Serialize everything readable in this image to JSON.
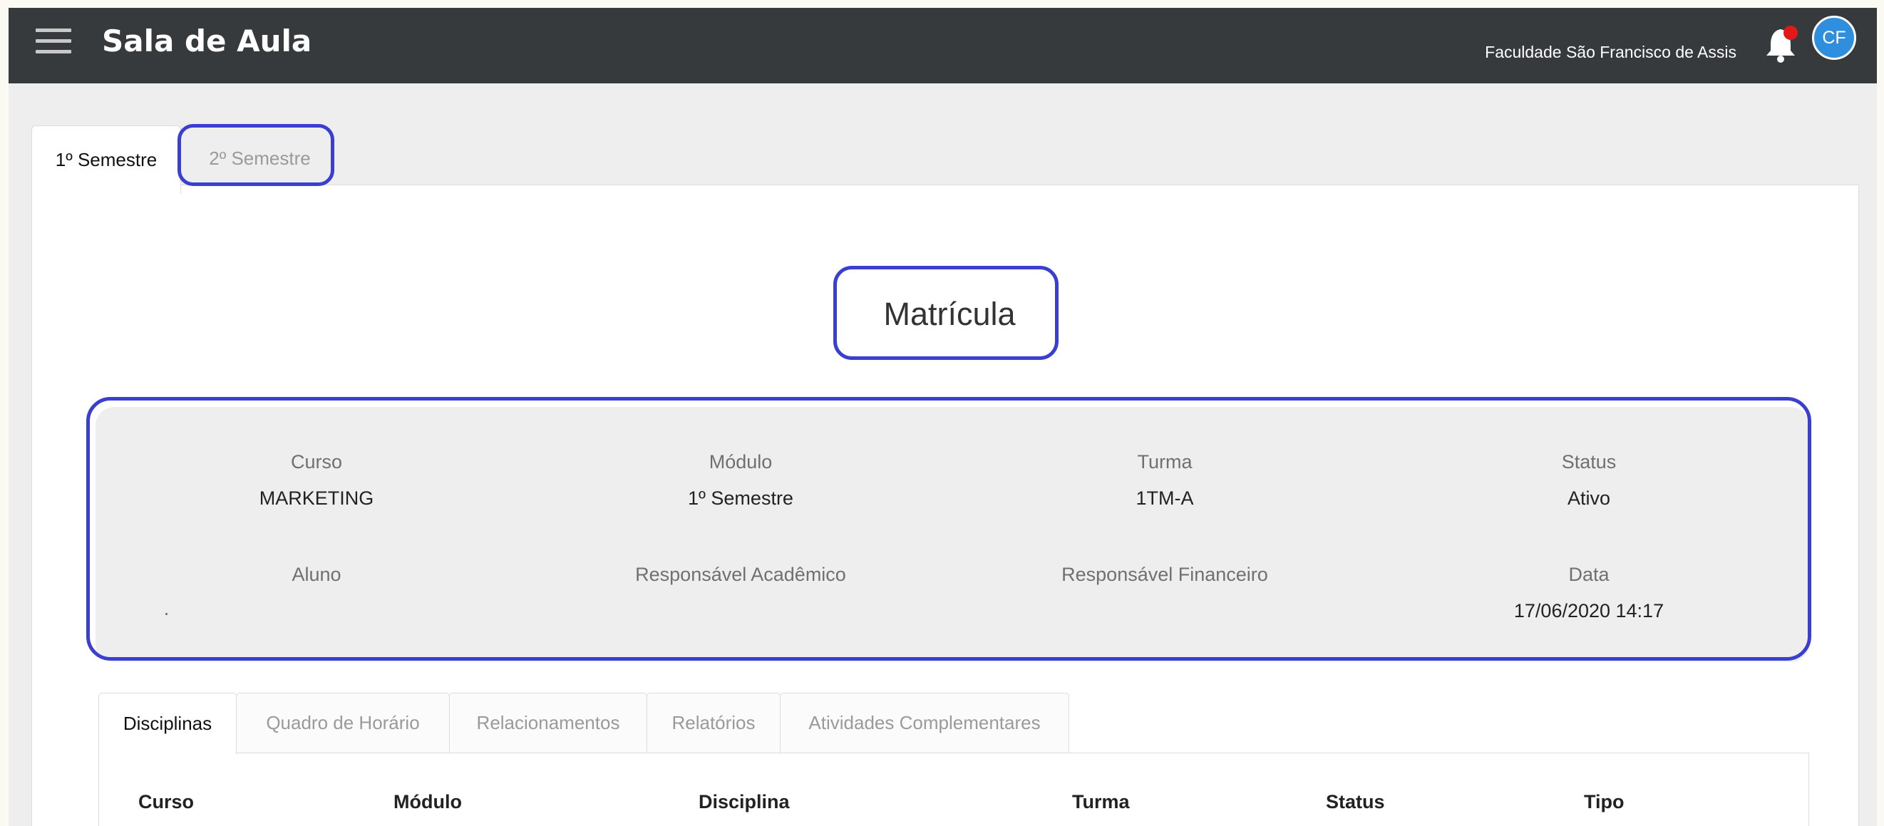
{
  "header": {
    "title": "Sala de Aula",
    "institution": "Faculdade São Francisco de Assis",
    "avatar_initials": "CF",
    "notification": true,
    "colors": {
      "bar": "#363a3c",
      "avatar": "#2f8fde",
      "highlight": "#3a3fd0"
    }
  },
  "semester_tabs": [
    {
      "label": "1º Semestre",
      "active": true
    },
    {
      "label": "2º Semestre",
      "active": false
    }
  ],
  "section_title": "Matrícula",
  "info": {
    "curso": {
      "label": "Curso",
      "value": "MARKETING"
    },
    "modulo": {
      "label": "Módulo",
      "value": "1º Semestre"
    },
    "turma": {
      "label": "Turma",
      "value": "1TM-A"
    },
    "status": {
      "label": "Status",
      "value": "Ativo"
    },
    "aluno": {
      "label": "Aluno",
      "value": ""
    },
    "resp_academico": {
      "label": "Responsável Acadêmico",
      "value": ""
    },
    "resp_financeiro": {
      "label": "Responsável Financeiro",
      "value": ""
    },
    "data": {
      "label": "Data",
      "value": "17/06/2020 14:17"
    }
  },
  "inner_tabs": [
    {
      "label": "Disciplinas",
      "active": true
    },
    {
      "label": "Quadro de Horário",
      "active": false
    },
    {
      "label": "Relacionamentos",
      "active": false
    },
    {
      "label": "Relatórios",
      "active": false
    },
    {
      "label": "Atividades Complementares",
      "active": false
    }
  ],
  "table": {
    "columns": [
      "Curso",
      "Módulo",
      "Disciplina",
      "Turma",
      "Status",
      "Tipo"
    ]
  }
}
